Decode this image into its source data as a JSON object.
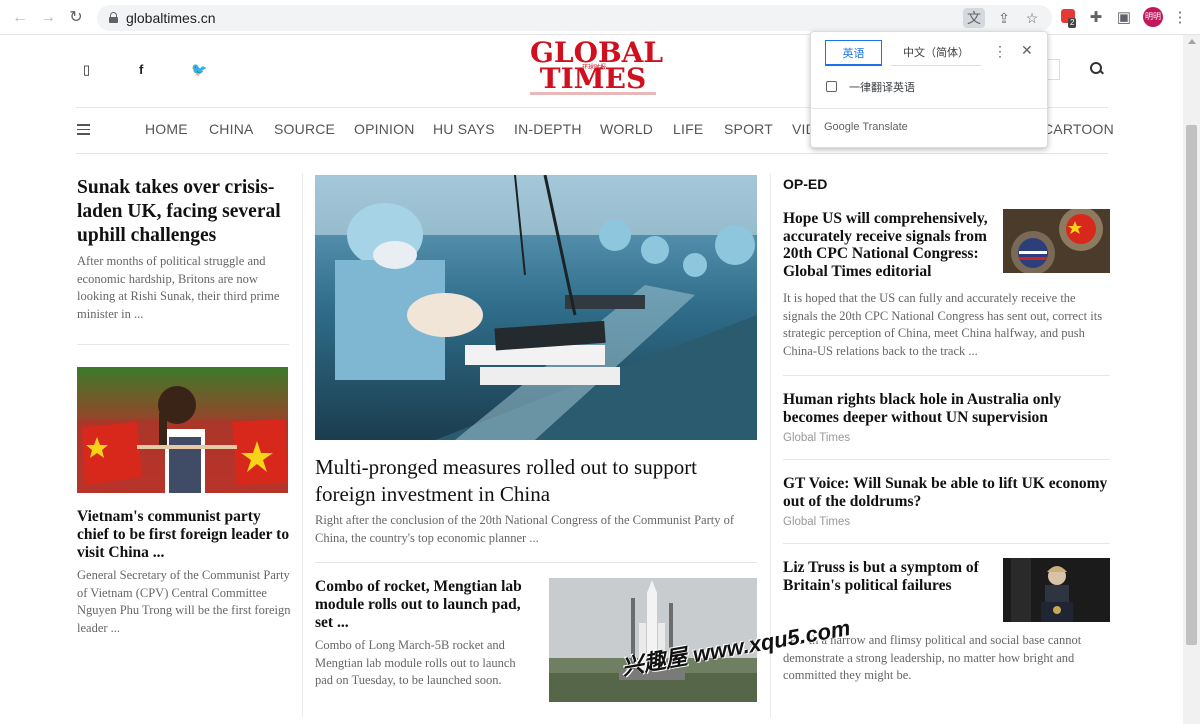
{
  "browser": {
    "url": "globaltimes.cn",
    "profile_label": "明明",
    "ext_badge": "2"
  },
  "site": {
    "logo_line1": "GLOBAL",
    "logo_line2": "TIMES",
    "logo_cn": "环球时报",
    "nav": [
      "HOME",
      "CHINA",
      "SOURCE",
      "OPINION",
      "HU SAYS",
      "IN-DEPTH",
      "WORLD",
      "LIFE",
      "SPORT",
      "VID",
      "CARTOON"
    ]
  },
  "translate_popup": {
    "tab_active": "英语",
    "tab_other": "中文（简体）",
    "checkbox_label": "一律翻译英语",
    "footer": "Google Translate"
  },
  "left": {
    "story1": {
      "headline": "Sunak takes over crisis-laden UK, facing several uphill challenges",
      "summary": "After months of political struggle and economic hardship, Britons are now looking at Rishi Sunak, their third prime minister in ..."
    },
    "story2": {
      "headline": "Vietnam's communist party chief to be first foreign leader to visit China ...",
      "summary": "General Secretary of the Communist Party of Vietnam (CPV) Central Committee Nguyen Phu Trong will be the first foreign leader ..."
    }
  },
  "center": {
    "main": {
      "headline": "Multi-pronged measures rolled out to support foreign investment in China",
      "summary": "Right after the conclusion of the 20th National Congress of the Communist Party of China, the country's top economic planner ..."
    },
    "second": {
      "headline": "Combo of rocket, Mengtian lab module rolls out to launch pad, set ...",
      "summary": "Combo of Long March-5B rocket and Mengtian lab module rolls out to launch pad on Tuesday, to be launched soon."
    }
  },
  "oped": {
    "title": "OP-ED",
    "items": [
      {
        "headline": "Hope US will comprehensively, accurately receive signals from 20th CPC National Congress: Global Times editorial",
        "summary": "It is hoped that the US can fully and accurately receive the signals the 20th CPC National Congress has sent out, correct its strategic perception of China, meet China halfway, and push China-US relations back to the track ..."
      },
      {
        "headline": "Human rights black hole in Australia only becomes deeper without UN supervision",
        "source": "Global Times"
      },
      {
        "headline": "GT Voice: Will Sunak be able to lift UK economy out of the doldrums?",
        "source": "Global Times"
      },
      {
        "headline": "Liz Truss is but a symptom of Britain's political failures",
        "summary": "Le... th a narrow and flimsy political and social base cannot demonstrate a strong leadership, no matter how bright and committed they might be."
      }
    ]
  },
  "watermark": "兴趣屋 www.xqu5.com",
  "colors": {
    "brand_red": "#d0101f",
    "translate_blue": "#1a73e8"
  }
}
